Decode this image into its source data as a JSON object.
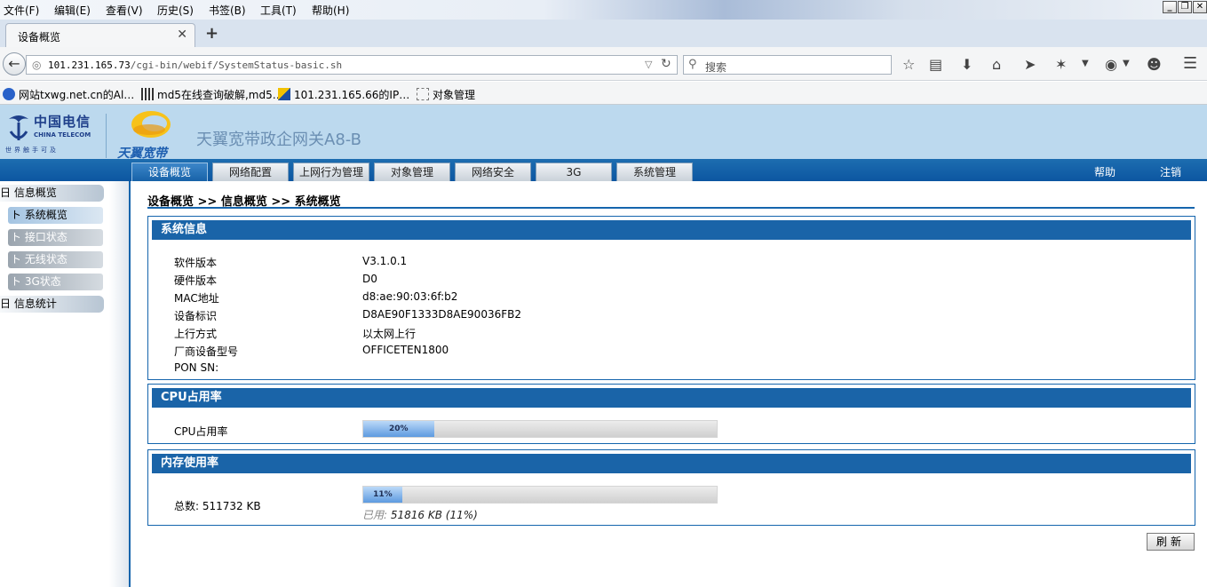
{
  "browser": {
    "menu": [
      "文件(F)",
      "编辑(E)",
      "查看(V)",
      "历史(S)",
      "书签(B)",
      "工具(T)",
      "帮助(H)"
    ],
    "window_controls": [
      "_",
      "❐",
      "✕"
    ],
    "tab_title": "设备概览",
    "new_tab": "+",
    "url_host": "101.231.165.73",
    "url_path": "/cgi-bin/webif/SystemStatus-basic.sh",
    "search_placeholder": "搜索",
    "bookmarks": [
      "网站txwg.net.cn的Al…",
      "md5在线查询破解,md5…",
      "101.231.165.66的IP…",
      "对象管理"
    ]
  },
  "header": {
    "brand_cn": "中国电信",
    "brand_en": "CHINA TELECOM",
    "brand_slogan": "世界触手可及",
    "sub_brand": "天翼宽带",
    "product_name": "天翼宽带政企网关A8-B"
  },
  "nav": {
    "tabs": [
      "设备概览",
      "网络配置",
      "上网行为管理",
      "对象管理",
      "网络安全",
      "3G",
      "系统管理"
    ],
    "help": "帮助",
    "logout": "注销"
  },
  "sidebar": {
    "groups": [
      {
        "label": "日 信息概览",
        "items": [
          "ト 系统概览",
          "ト 接口状态",
          "ト 无线状态",
          "ト 3G状态"
        ]
      },
      {
        "label": "日 信息统计",
        "items": []
      }
    ]
  },
  "breadcrumb": "设备概览 >> 信息概览 >> 系统概览",
  "system_info": {
    "title": "系统信息",
    "rows": [
      {
        "label": "软件版本",
        "value": "V3.1.0.1"
      },
      {
        "label": "硬件版本",
        "value": "D0"
      },
      {
        "label": "MAC地址",
        "value": "d8:ae:90:03:6f:b2"
      },
      {
        "label": "设备标识",
        "value": "D8AE90F1333D8AE90036FB2"
      },
      {
        "label": "上行方式",
        "value": "以太网上行"
      },
      {
        "label": "厂商设备型号",
        "value": "OFFICETEN1800"
      },
      {
        "label": "PON SN:",
        "value": ""
      }
    ]
  },
  "cpu": {
    "title": "CPU占用率",
    "label": "CPU占用率",
    "percent": 20,
    "percent_text": "20%"
  },
  "memory": {
    "title": "内存使用率",
    "total_label": "总数: 511732 KB",
    "percent": 11,
    "percent_text": "11%",
    "used_label": "已用:",
    "used_value": "51816 KB (11%)"
  },
  "refresh_label": "刷新"
}
